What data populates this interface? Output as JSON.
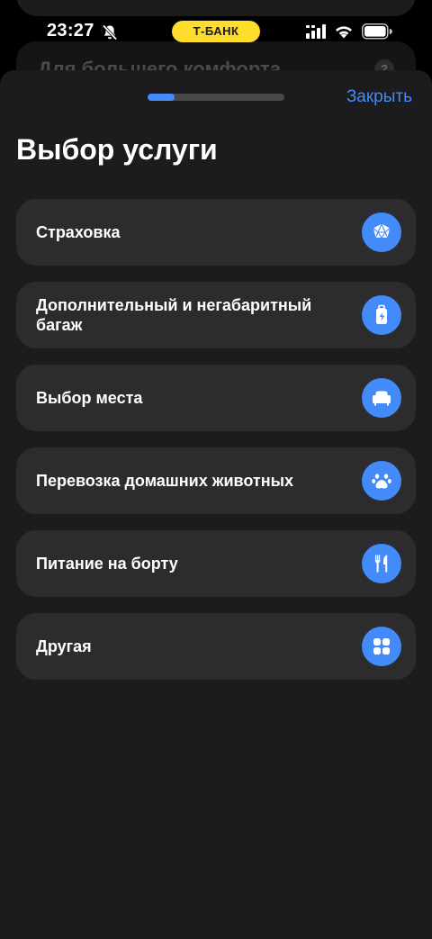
{
  "background_screen": {
    "text": "Для большего комфорта",
    "help_glyph": "?"
  },
  "status_bar": {
    "time": "23:27",
    "carrier_badge": "Т-БАНК",
    "icons": [
      "bell-slash-icon",
      "signal-icon",
      "wifi-icon",
      "battery-icon"
    ]
  },
  "sheet": {
    "progress_fraction": 0.2,
    "close_label": "Закрыть",
    "title": "Выбор услуги"
  },
  "services": [
    {
      "label": "Страховка",
      "icon": "insurance-icon"
    },
    {
      "label": "Дополнительный и негабаритный багаж",
      "icon": "luggage-icon"
    },
    {
      "label": "Выбор места",
      "icon": "seat-icon"
    },
    {
      "label": "Перевозка домашних животных",
      "icon": "paw-icon"
    },
    {
      "label": "Питание на борту",
      "icon": "meal-icon"
    },
    {
      "label": "Другая",
      "icon": "grid-icon"
    }
  ],
  "colors": {
    "accent": "#428bf9",
    "sheet_background": "#1c1c1e",
    "item_background": "#2c2c2e",
    "badge_yellow": "#ffdd2d"
  }
}
